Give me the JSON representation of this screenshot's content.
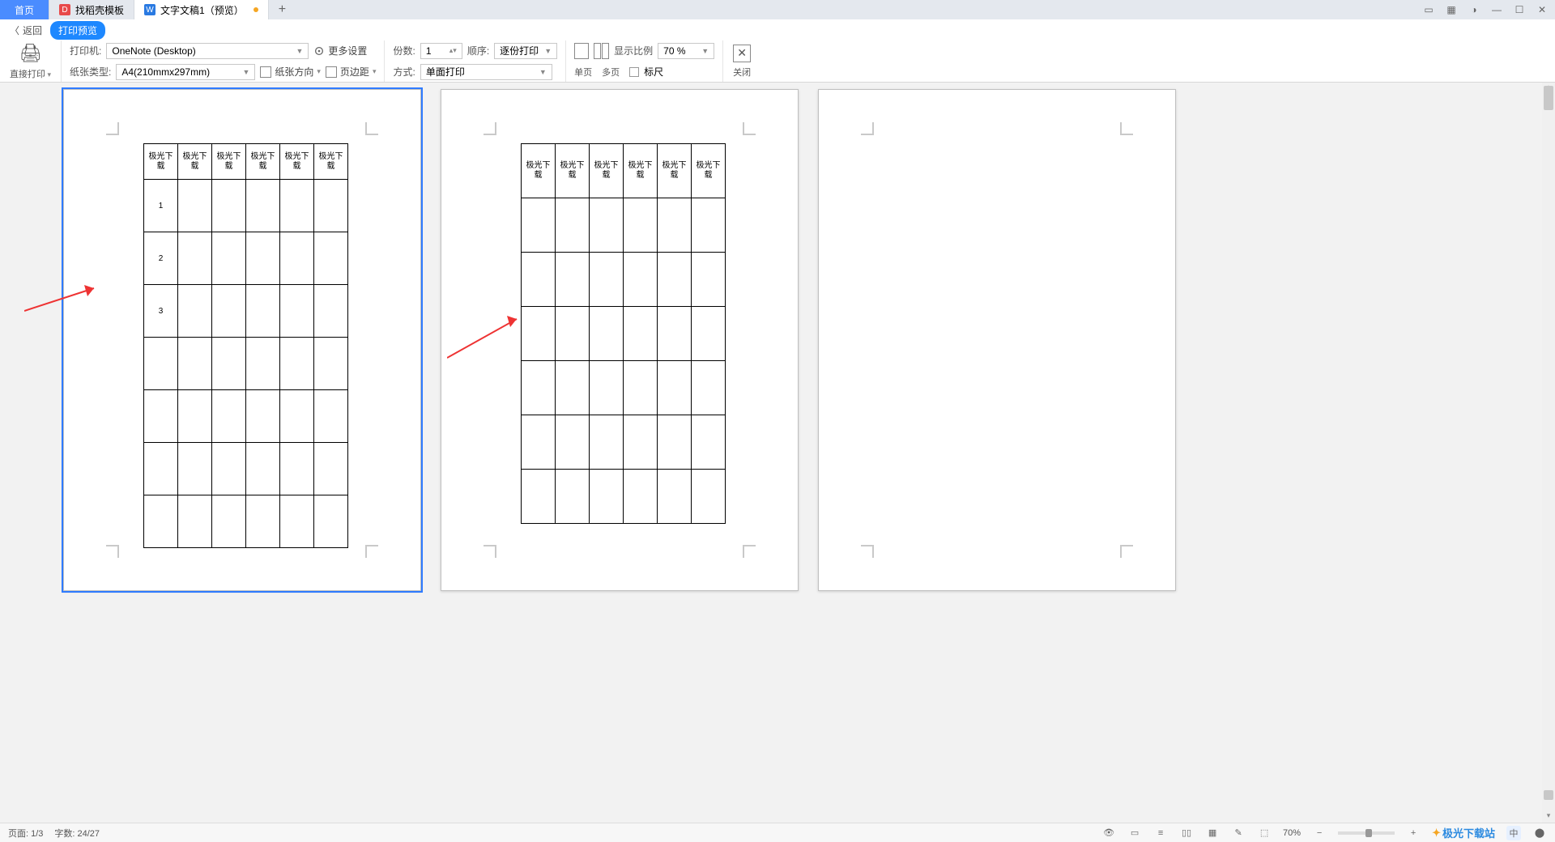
{
  "tabs": {
    "home": "首页",
    "templates": "找稻壳模板",
    "doc": "文字文稿1（预览）"
  },
  "ribbon": {
    "back": "返回",
    "mode": "打印预览"
  },
  "toolbar": {
    "direct_print": "直接打印",
    "printer_label": "打印机:",
    "printer_value": "OneNote (Desktop)",
    "paper_type_label": "纸张类型:",
    "paper_type_value": "A4(210mmx297mm)",
    "more_settings": "更多设置",
    "orientation": "纸张方向",
    "margins": "页边距",
    "copies_label": "份数:",
    "copies_value": "1",
    "order_label": "顺序:",
    "order_value": "逐份打印",
    "mode_label": "方式:",
    "mode_value": "单面打印",
    "single_page": "单页",
    "multi_page": "多页",
    "scale_label": "显示比例",
    "scale_value": "70 %",
    "ruler": "标尺",
    "close": "关闭"
  },
  "table": {
    "header": "极光下载",
    "rows": [
      "1",
      "2",
      "3"
    ]
  },
  "status": {
    "page": "页面: 1/3",
    "words": "字数: 24/27",
    "zoom": "70%",
    "brand": "极光下载站",
    "ime": "中"
  }
}
